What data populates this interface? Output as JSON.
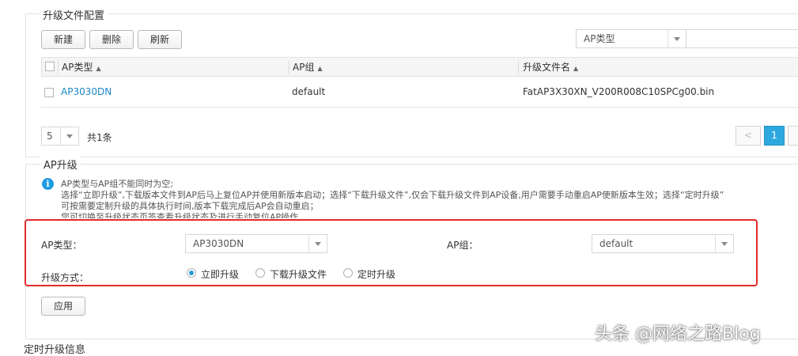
{
  "upgrade_file_config": {
    "title": "升级文件配置",
    "buttons": {
      "new": "新建",
      "delete": "删除",
      "refresh": "刷新"
    },
    "filter": {
      "select_value": "AP类型",
      "search_value": ""
    },
    "table": {
      "headers": [
        "AP类型",
        "AP组",
        "升级文件名"
      ],
      "sort_glyph": "▲",
      "rows": [
        {
          "ap_type": "AP3030DN",
          "ap_group": "default",
          "file_name": "FatAP3X30XN_V200R008C10SPCg00.bin"
        }
      ]
    },
    "pagination": {
      "page_size": "5",
      "total": "共1条",
      "prev": "<",
      "current_page": "1"
    }
  },
  "ap_upgrade": {
    "title": "AP升级",
    "info_icon": "i",
    "info_lines": [
      "AP类型与AP组不能同时为空;",
      "选择“立即升级”,下载版本文件到AP后马上复位AP并使用新版本启动；选择“下载升级文件”,仅会下载升级文件到AP设备,用户需要手动重启AP使新版本生效；选择“定时升级”",
      "可按需要定制升级的具体执行时间,版本下载完成后AP会自动重启；",
      "您可切换至升级状态页签查看升级状态及进行手动复位AP操作"
    ],
    "form": {
      "ap_type_label": "AP类型：",
      "ap_type_value": "AP3030DN",
      "ap_group_label": "AP组：",
      "ap_group_value": "default",
      "method_label": "升级方式：",
      "methods": [
        "立即升级",
        "下载升级文件",
        "定时升级"
      ],
      "selected_method": "立即升级"
    },
    "apply_button": "应用"
  },
  "scheduled_upgrade": {
    "title": "定时升级信息"
  },
  "watermark": "头条 @网络之路Blog"
}
